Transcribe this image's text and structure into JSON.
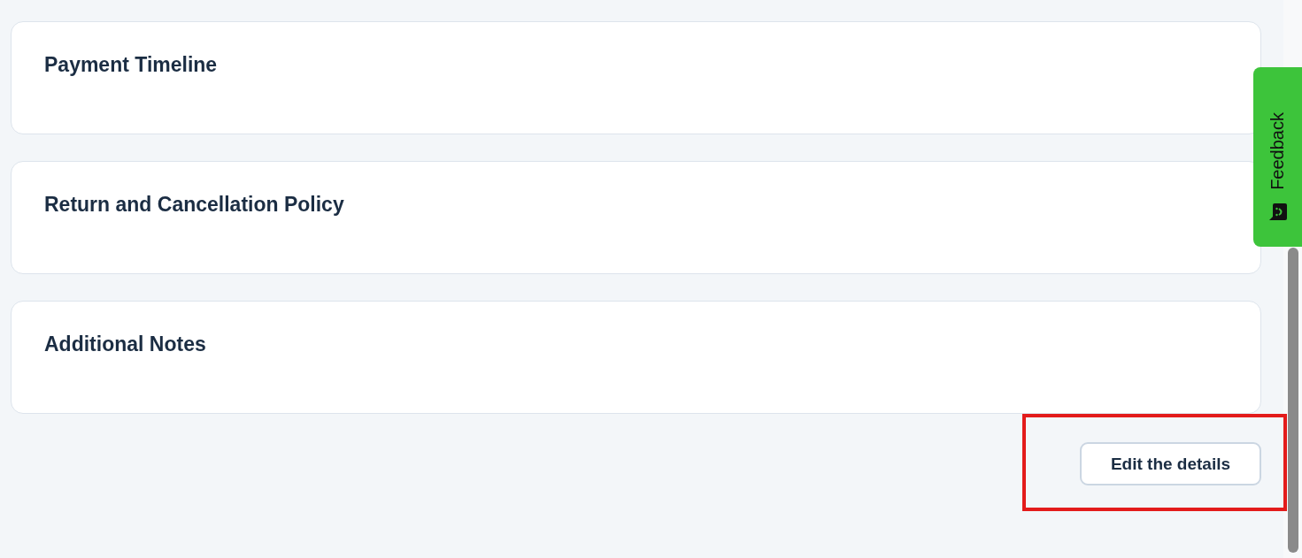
{
  "sections": [
    {
      "title": "Payment Timeline"
    },
    {
      "title": "Return and Cancellation Policy"
    },
    {
      "title": "Additional Notes"
    }
  ],
  "edit_button": {
    "label": "Edit the details",
    "highlighted": true
  },
  "feedback_tab": {
    "label": "Feedback"
  }
}
